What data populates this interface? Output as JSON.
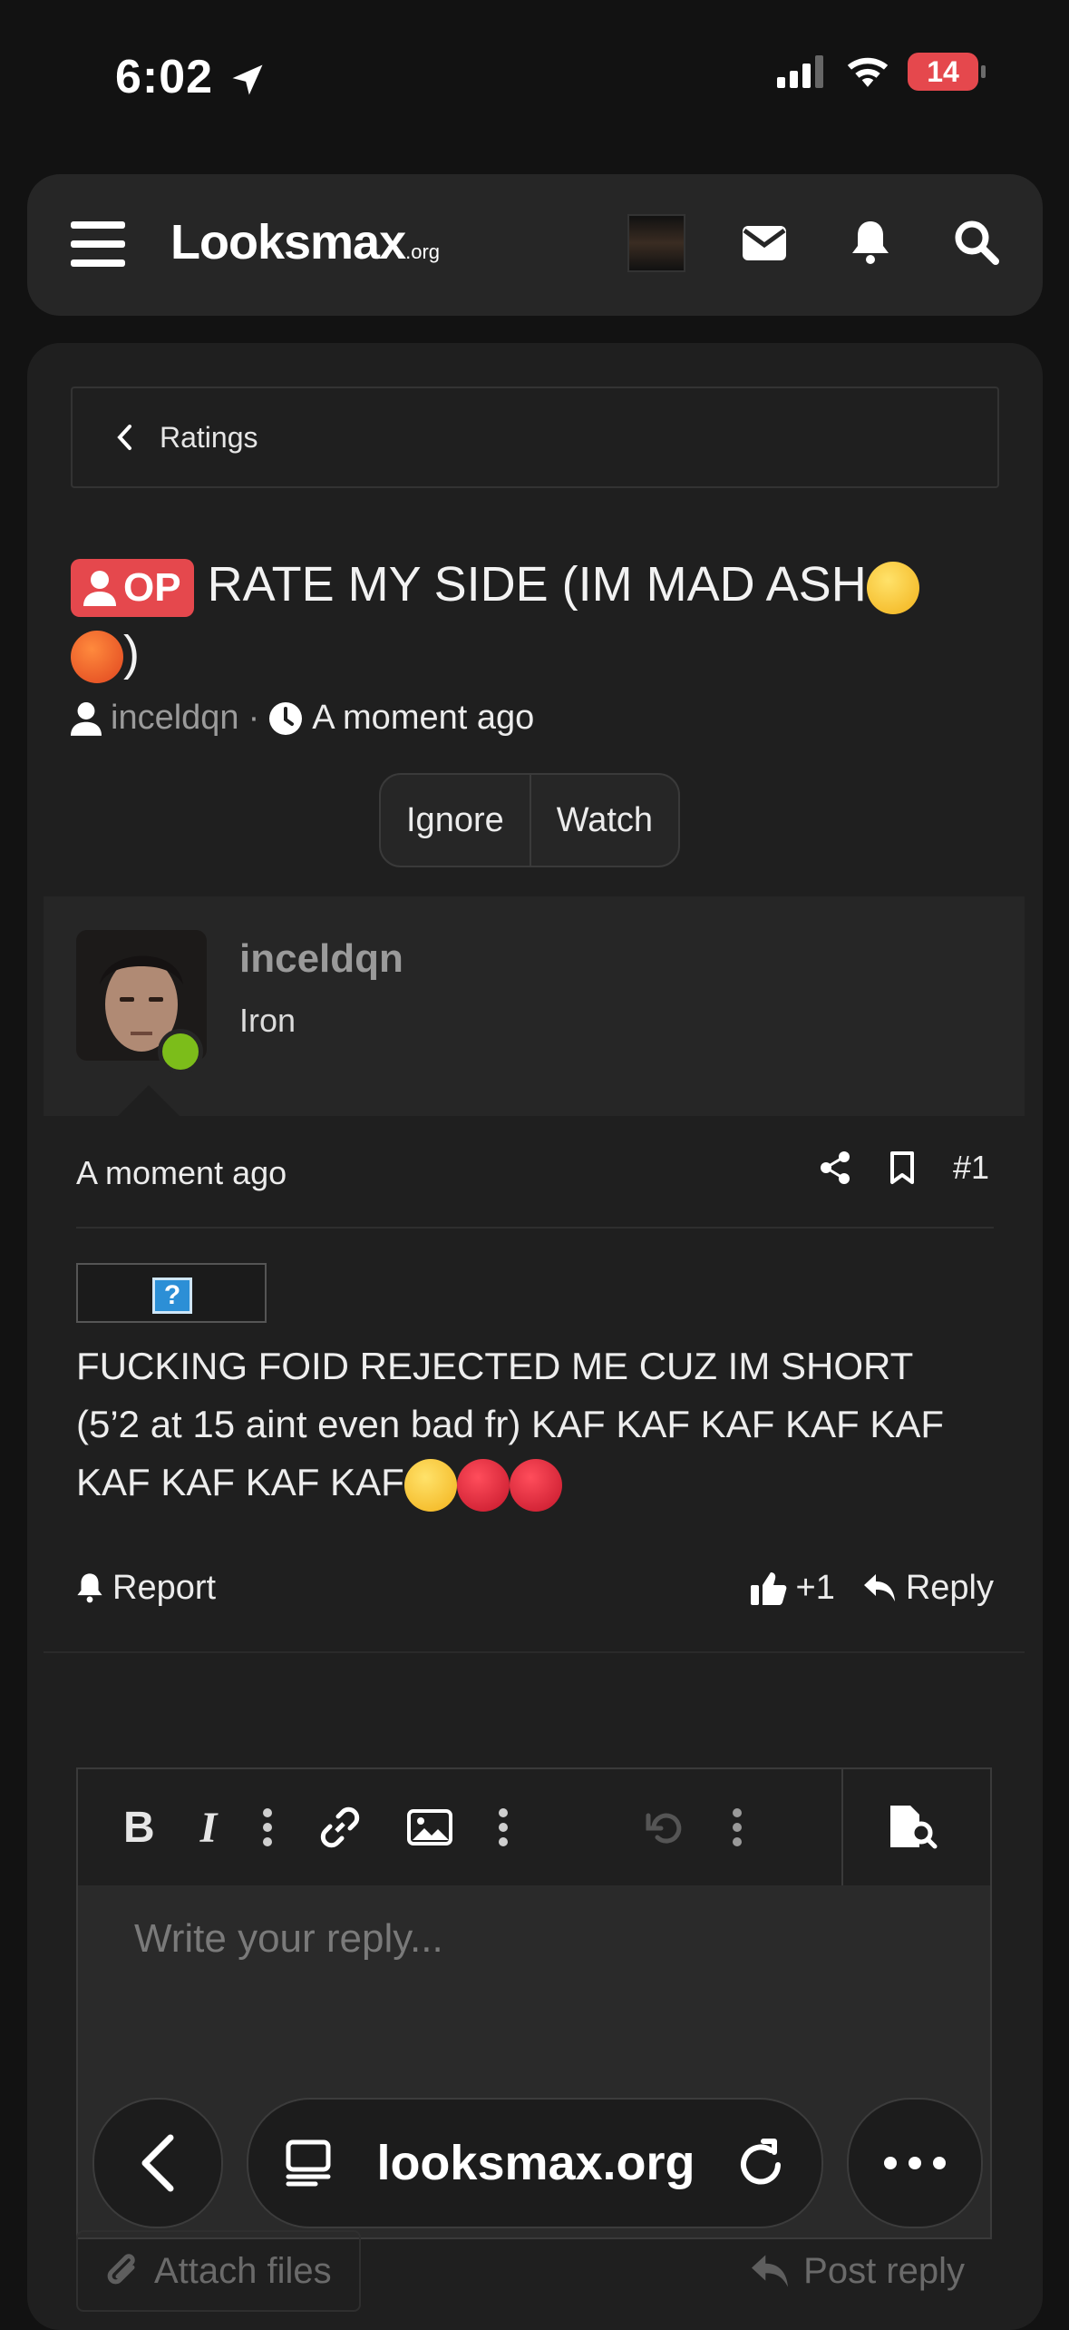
{
  "status_bar": {
    "time": "6:02",
    "battery": "14"
  },
  "header": {
    "logo": "Looksmax",
    "logo_suffix": ".org",
    "icons": [
      "menu-icon",
      "avatar",
      "envelope-icon",
      "bell-icon",
      "search-icon"
    ]
  },
  "breadcrumb": {
    "label": "Ratings"
  },
  "thread": {
    "op_badge": "OP",
    "title": "RATE MY SIDE (IM MAD ASH",
    "title_end": ")",
    "author": "inceldqn",
    "time": "A moment ago",
    "actions": [
      "Ignore",
      "Watch"
    ]
  },
  "post": {
    "username": "inceldqn",
    "rank": "Iron",
    "time": "A moment ago",
    "number": "#1",
    "image_placeholder": "?",
    "body": "FUCKING FOID REJECTED ME CUZ IM SHORT (5’2 at 15 aint even bad fr) KAF KAF KAF KAF KAF KAF KAF KAF KAF",
    "report": "Report",
    "likes": "+1",
    "reply": "Reply"
  },
  "editor": {
    "placeholder": "Write your reply...",
    "attach": "Attach files",
    "post_reply": "Post reply"
  },
  "safari": {
    "url": "looksmax.org"
  },
  "colors": {
    "accent_red": "#e5484d",
    "online": "#7cbd1a",
    "background": "#121212"
  }
}
